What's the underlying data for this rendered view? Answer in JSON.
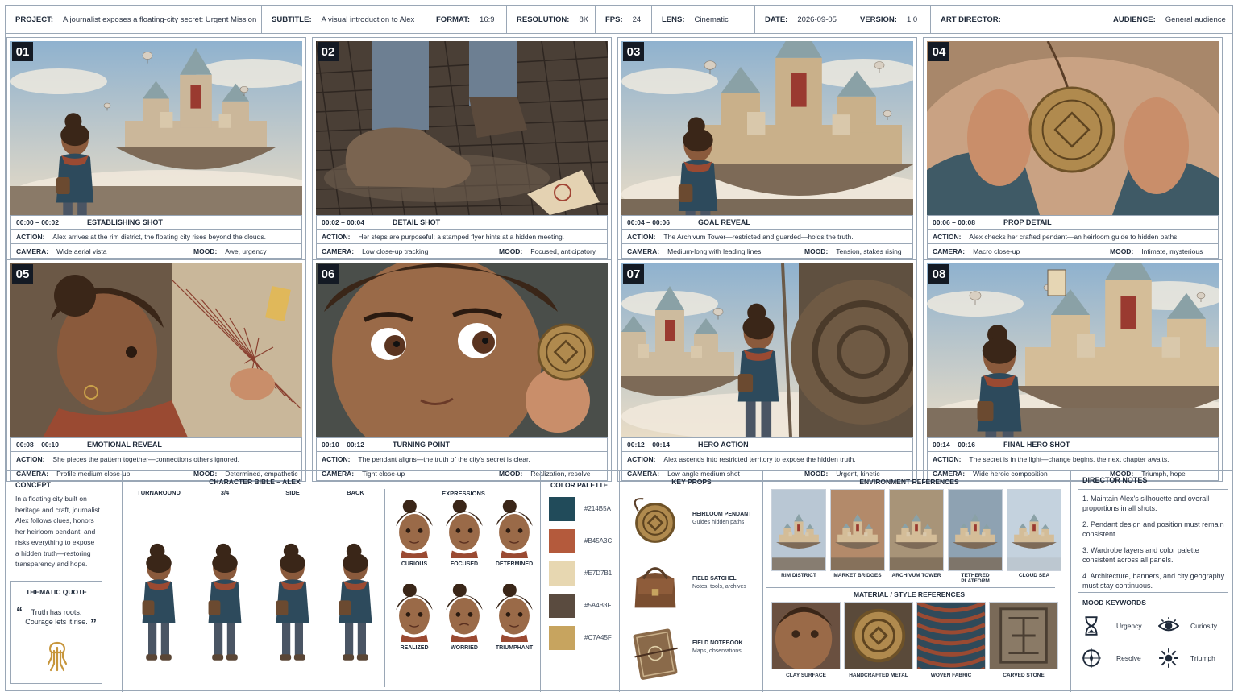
{
  "header": {
    "project_label": "PROJECT:",
    "project": "A journalist exposes a floating-city secret: Urgent Mission",
    "subtitle_label": "SUBTITLE:",
    "subtitle": "A visual introduction to Alex",
    "format_label": "FORMAT:",
    "format": "16:9",
    "resolution_label": "RESOLUTION:",
    "resolution": "8K",
    "fps_label": "FPS:",
    "fps": "24",
    "lens_label": "LENS:",
    "lens": "Cinematic",
    "date_label": "DATE:",
    "date": "2026-09-05",
    "version_label": "VERSION:",
    "version": "1.0",
    "art_director_label": "ART DIRECTOR:",
    "audience_label": "AUDIENCE:",
    "audience": "General audience"
  },
  "labels": {
    "action": "ACTION:",
    "camera": "CAMERA:",
    "mood": "MOOD:"
  },
  "panels": [
    {
      "num": "01",
      "time": "00:00 – 00:02",
      "shot": "ESTABLISHING SHOT",
      "action": "Alex arrives at the rim district, the floating city rises beyond the clouds.",
      "camera": "Wide aerial vista",
      "mood": "Awe, urgency"
    },
    {
      "num": "02",
      "time": "00:02 – 00:04",
      "shot": "DETAIL SHOT",
      "action": "Her steps are purposeful; a stamped flyer hints at a hidden meeting.",
      "camera": "Low close-up tracking",
      "mood": "Focused, anticipatory"
    },
    {
      "num": "03",
      "time": "00:04 – 00:06",
      "shot": "GOAL REVEAL",
      "action": "The Archivum Tower—restricted and guarded—holds the truth.",
      "camera": "Medium-long with leading lines",
      "mood": "Tension, stakes rising"
    },
    {
      "num": "04",
      "time": "00:06 – 00:08",
      "shot": "PROP DETAIL",
      "action": "Alex checks her crafted pendant—an heirloom guide to hidden paths.",
      "camera": "Macro close-up",
      "mood": "Intimate, mysterious"
    },
    {
      "num": "05",
      "time": "00:08 – 00:10",
      "shot": "EMOTIONAL REVEAL",
      "action": "She pieces the pattern together—connections others ignored.",
      "camera": "Profile medium close-up",
      "mood": "Determined, empathetic"
    },
    {
      "num": "06",
      "time": "00:10 – 00:12",
      "shot": "TURNING POINT",
      "action": "The pendant aligns—the truth of the city's secret is clear.",
      "camera": "Tight close-up",
      "mood": "Realization, resolve"
    },
    {
      "num": "07",
      "time": "00:12 – 00:14",
      "shot": "HERO ACTION",
      "action": "Alex ascends into restricted territory to expose the hidden truth.",
      "camera": "Low angle medium shot",
      "mood": "Urgent, kinetic"
    },
    {
      "num": "08",
      "time": "00:14 – 00:16",
      "shot": "FINAL HERO SHOT",
      "action": "The secret is in the light—change begins, the next chapter awaits.",
      "camera": "Wide heroic composition",
      "mood": "Triumph, hope"
    }
  ],
  "concept": {
    "title": "CONCEPT",
    "lines": [
      "In a floating city built on",
      "heritage and craft, journalist",
      "Alex follows clues, honors",
      "her heirloom pendant, and",
      "risks everything to expose",
      "a hidden truth—restoring",
      "transparency and hope."
    ]
  },
  "quote": {
    "title": "THEMATIC QUOTE",
    "line1": "Truth has roots.",
    "line2": "Courage lets it rise."
  },
  "character_bible": {
    "title": "CHARACTER BIBLE – ALEX",
    "views": [
      "TURNAROUND",
      "3/4",
      "SIDE",
      "BACK"
    ],
    "expressions_title": "EXPRESSIONS",
    "expressions": [
      "CURIOUS",
      "FOCUSED",
      "DETERMINED",
      "REALIZED",
      "WORRIED",
      "TRIUMPHANT"
    ]
  },
  "palette": {
    "title": "COLOR PALETTE",
    "colors": [
      "#214B5A",
      "#B45A3C",
      "#E7D7B1",
      "#5A4B3F",
      "#C7A45F"
    ]
  },
  "props": {
    "title": "KEY PROPS",
    "items": [
      {
        "name": "HEIRLOOM PENDANT",
        "desc": "Guides hidden paths"
      },
      {
        "name": "FIELD SATCHEL",
        "desc": "Notes, tools, archives"
      },
      {
        "name": "FIELD NOTEBOOK",
        "desc": "Maps, observations"
      }
    ]
  },
  "environment": {
    "title": "ENVIRONMENT REFERENCES",
    "items": [
      "RIM DISTRICT",
      "MARKET BRIDGES",
      "ARCHIVUM TOWER",
      "TETHERED PLATFORM",
      "CLOUD SEA"
    ],
    "material_title": "MATERIAL / STYLE REFERENCES",
    "materials": [
      "CLAY SURFACE",
      "HANDCRAFTED METAL",
      "WOVEN FABRIC",
      "CARVED STONE"
    ]
  },
  "director": {
    "title": "DIRECTOR NOTES",
    "notes": [
      "1.  Maintain Alex's silhouette and overall proportions in all shots.",
      "2.  Pendant design and position must remain consistent.",
      "3.  Wardrobe layers and color palette consistent across all panels.",
      "4.  Architecture, banners, and city geography must stay continuous."
    ],
    "mood_title": "MOOD KEYWORDS",
    "moods": [
      "Urgency",
      "Curiosity",
      "Resolve",
      "Triumph"
    ]
  }
}
